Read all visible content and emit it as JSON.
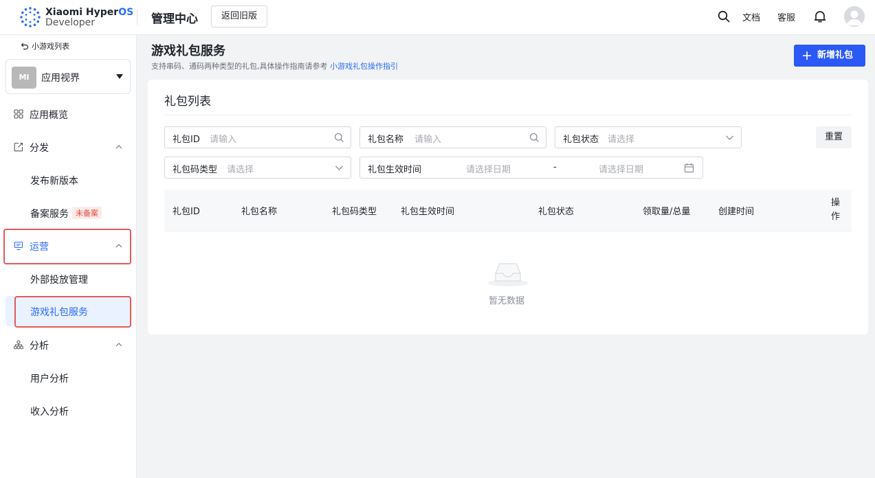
{
  "brand": {
    "line1_a": "Xiaomi Hyper",
    "line1_b": "OS",
    "line2": "Developer"
  },
  "topbar": {
    "title": "管理中心",
    "old_version_button": "返回旧版",
    "docs": "文档",
    "service": "客服",
    "icons": [
      "search-icon",
      "bell-icon",
      "avatar"
    ]
  },
  "sidebar": {
    "back_link": "小游戏列表",
    "app": {
      "icon_text": "MI",
      "name": "应用视界"
    },
    "items": [
      {
        "label": "应用概览",
        "icon": "grid-icon"
      },
      {
        "label": "分发",
        "icon": "share-icon",
        "expanded": true
      },
      {
        "label": "发布新版本"
      },
      {
        "label": "备案服务",
        "badge": "未备案"
      },
      {
        "label": "运营",
        "icon": "monitor-icon",
        "expanded": true,
        "highlighted": true
      },
      {
        "label": "外部投放管理"
      },
      {
        "label": "游戏礼包服务",
        "active": true,
        "highlighted": true
      },
      {
        "label": "分析",
        "icon": "org-icon",
        "expanded": true
      },
      {
        "label": "用户分析"
      },
      {
        "label": "收入分析"
      }
    ]
  },
  "main": {
    "title": "游戏礼包服务",
    "subtitle": "支持串码、通码两种类型的礼包,具体操作指南请参考",
    "subtitle_link": "小游戏礼包操作指引",
    "add_button": "新增礼包",
    "card_title": "礼包列表",
    "filters": {
      "gift_id": {
        "label": "礼包ID",
        "placeholder": "请输入"
      },
      "gift_name": {
        "label": "礼包名称",
        "placeholder": "请输入"
      },
      "gift_status": {
        "label": "礼包状态",
        "placeholder": "请选择"
      },
      "code_type": {
        "label": "礼包码类型",
        "placeholder": "请选择"
      },
      "effective_time": {
        "label": "礼包生效时间",
        "start_placeholder": "请选择日期",
        "separator": "-",
        "end_placeholder": "请选择日期"
      },
      "reset_button": "重置"
    },
    "table": {
      "columns": [
        "礼包ID",
        "礼包名称",
        "礼包码类型",
        "礼包生效时间",
        "礼包状态",
        "领取量/总量",
        "创建时间",
        "操作"
      ],
      "rows": [],
      "empty_text": "暂无数据"
    }
  },
  "colors": {
    "primary": "#2b59f5",
    "link": "#2b6cf6",
    "highlight_box": "#e05a5a",
    "badge_text": "#e8483f"
  }
}
